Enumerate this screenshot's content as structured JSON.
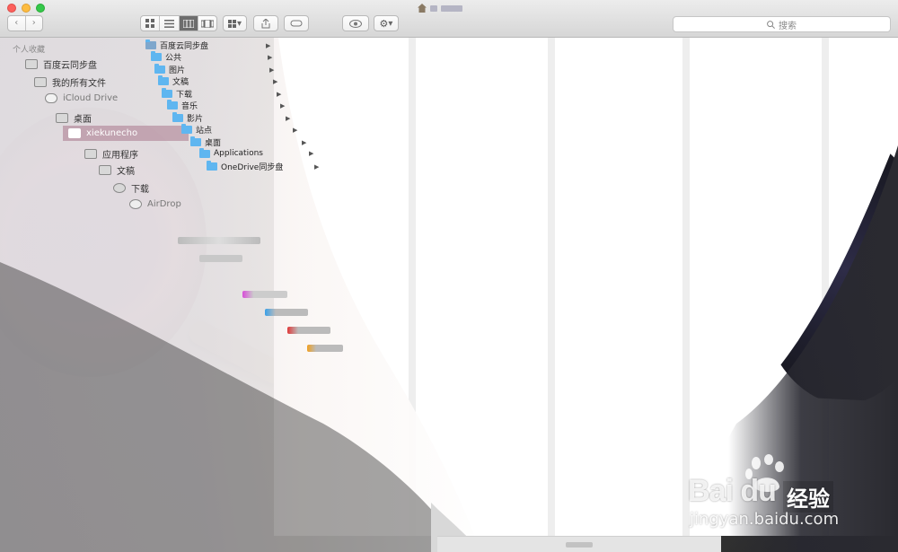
{
  "window": {
    "title_blurred": true
  },
  "toolbar": {
    "back_label": "‹",
    "forward_label": "›",
    "view_icons": [
      "icon-view-icon",
      "list-view-icon",
      "column-view-icon",
      "coverflow-view-icon"
    ],
    "arrange_label": "▾",
    "action_label": "▾",
    "search_placeholder": "搜索"
  },
  "sidebar": {
    "header": "个人收藏",
    "items": [
      {
        "label": "百度云同步盘",
        "icon": "folder-icon"
      },
      {
        "label": "我的所有文件",
        "icon": "all-files-icon"
      },
      {
        "label": "iCloud Drive",
        "icon": "cloud-icon"
      },
      {
        "label": "桌面",
        "icon": "desktop-icon"
      },
      {
        "label": "xiekunecho",
        "icon": "home-icon",
        "selected": true
      },
      {
        "label": "应用程序",
        "icon": "applications-icon"
      },
      {
        "label": "文稿",
        "icon": "documents-icon"
      },
      {
        "label": "下载",
        "icon": "downloads-icon"
      },
      {
        "label": "AirDrop",
        "icon": "airdrop-icon"
      }
    ]
  },
  "column1": {
    "items": [
      {
        "label": "百度云同步盘"
      },
      {
        "label": "公共"
      },
      {
        "label": "图片"
      },
      {
        "label": "文稿"
      },
      {
        "label": "下载"
      },
      {
        "label": "音乐"
      },
      {
        "label": "影片"
      },
      {
        "label": "站点"
      },
      {
        "label": "桌面"
      },
      {
        "label": "Applications"
      },
      {
        "label": "OneDrive同步盘"
      }
    ]
  },
  "watermark": {
    "logo": "Bai du",
    "product": "经验",
    "url": "jingyan.baidu.com"
  },
  "colors": {
    "folder": "#5fb6f0",
    "selected_row": "#aa788c",
    "close": "#fc605c",
    "minimize": "#fdbc40",
    "zoom": "#34c84a"
  }
}
